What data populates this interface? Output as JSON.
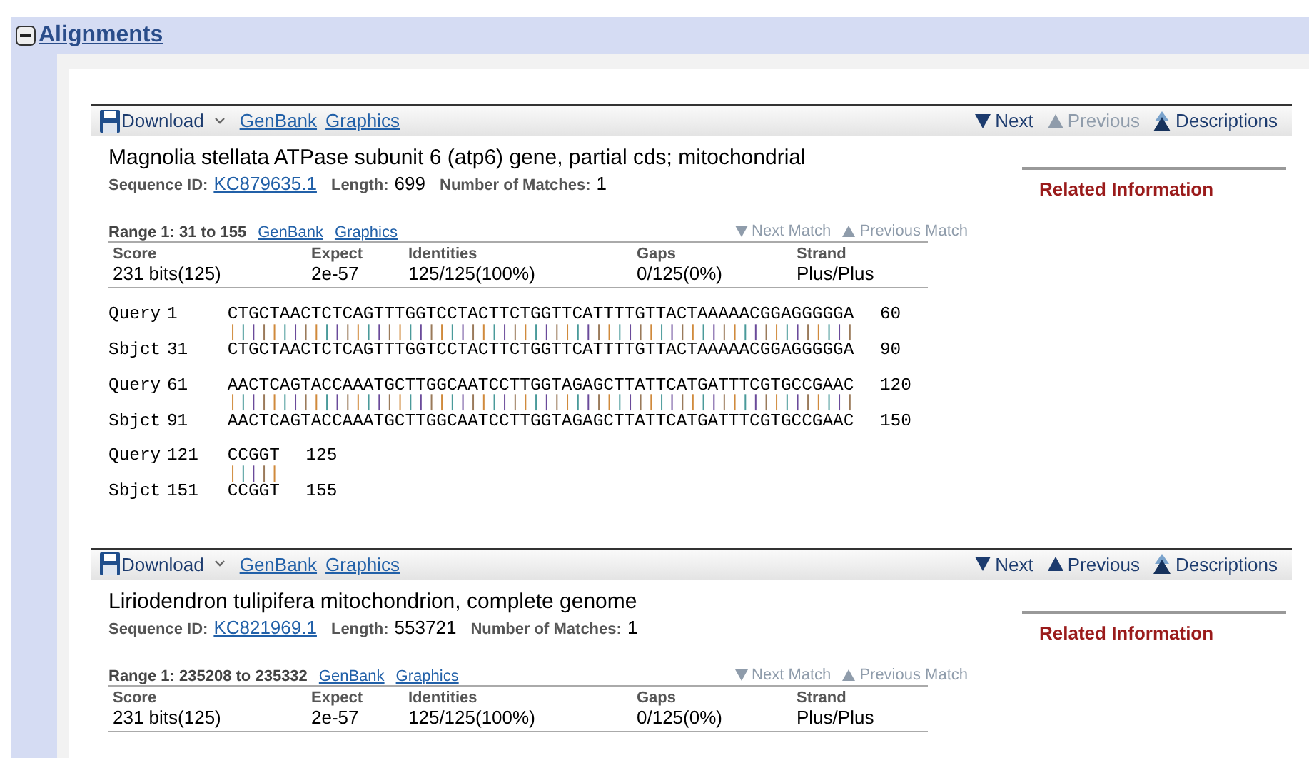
{
  "header": {
    "title": "Alignments",
    "expanded": true
  },
  "sections": [
    {
      "toolbar": {
        "download": "Download",
        "links": [
          "GenBank",
          "Graphics"
        ],
        "nav": [
          {
            "label": "Next",
            "kind": "down",
            "disabled": false
          },
          {
            "label": "Previous",
            "kind": "up",
            "disabled": true
          },
          {
            "label": "Descriptions",
            "kind": "top",
            "disabled": false
          }
        ]
      },
      "title": "Magnolia stellata ATPase subunit 6 (atp6) gene, partial cds; mitochondrial",
      "info": [
        {
          "label": "Sequence ID:",
          "value": "KC879635.1",
          "kind": "link"
        },
        {
          "label": "Length:",
          "value": "699",
          "kind": "text"
        },
        {
          "label": "Number of Matches:",
          "value": "1",
          "kind": "text"
        }
      ],
      "related": "Related Information",
      "range": "Range 1: 31 to 155",
      "range_links": [
        "GenBank",
        "Graphics"
      ],
      "match_nav": [
        {
          "label": "Next Match",
          "kind": "down",
          "disabled": true
        },
        {
          "label": "Previous Match",
          "kind": "up",
          "disabled": true
        }
      ],
      "stats": [
        {
          "header": "Score",
          "value": "231 bits(125)"
        },
        {
          "header": "Expect",
          "value": "2e-57"
        },
        {
          "header": "Identities",
          "value": "125/125(100%)"
        },
        {
          "header": "Gaps",
          "value": "0/125(0%)"
        },
        {
          "header": "Strand",
          "value": "Plus/Plus"
        }
      ],
      "blocks": [
        {
          "rows": [
            {
              "label": "Query",
              "start": "1",
              "seq": "CTGCTAACTCTCAGTTTGGTCCTACTTCTGGTTCATTTTGTTACTAAAAACGGAGGGGGA",
              "end": "60"
            },
            {
              "label": "Sbjct",
              "start": "31",
              "seq": "CTGCTAACTCTCAGTTTGGTCCTACTTCTGGTTCATTTTGTTACTAAAAACGGAGGGGGA",
              "end": "90"
            }
          ],
          "match": "||||||||||||||||||||||||||||||||||||||||||||||||||||||||||||"
        },
        {
          "rows": [
            {
              "label": "Query",
              "start": "61",
              "seq": "AACTCAGTACCAAATGCTTGGCAATCCTTGGTAGAGCTTATTCATGATTTCGTGCCGAAC",
              "end": "120"
            },
            {
              "label": "Sbjct",
              "start": "91",
              "seq": "AACTCAGTACCAAATGCTTGGCAATCCTTGGTAGAGCTTATTCATGATTTCGTGCCGAAC",
              "end": "150"
            }
          ],
          "match": "||||||||||||||||||||||||||||||||||||||||||||||||||||||||||||"
        },
        {
          "rows": [
            {
              "label": "Query",
              "start": "121",
              "seq": "CCGGT",
              "end": "125"
            },
            {
              "label": "Sbjct",
              "start": "151",
              "seq": "CCGGT",
              "end": "155"
            }
          ],
          "match": "|||||"
        }
      ]
    },
    {
      "toolbar": {
        "download": "Download",
        "links": [
          "GenBank",
          "Graphics"
        ],
        "nav": [
          {
            "label": "Next",
            "kind": "down",
            "disabled": false
          },
          {
            "label": "Previous",
            "kind": "up",
            "disabled": false
          },
          {
            "label": "Descriptions",
            "kind": "top",
            "disabled": false
          }
        ]
      },
      "title": "Liriodendron tulipifera mitochondrion, complete genome",
      "info": [
        {
          "label": "Sequence ID:",
          "value": "KC821969.1",
          "kind": "link"
        },
        {
          "label": "Length:",
          "value": "553721",
          "kind": "text"
        },
        {
          "label": "Number of Matches:",
          "value": "1",
          "kind": "text"
        }
      ],
      "related": "Related Information",
      "range": "Range 1: 235208 to 235332",
      "range_links": [
        "GenBank",
        "Graphics"
      ],
      "match_nav": [
        {
          "label": "Next Match",
          "kind": "down",
          "disabled": true
        },
        {
          "label": "Previous Match",
          "kind": "up",
          "disabled": true
        }
      ],
      "stats": [
        {
          "header": "Score",
          "value": "231 bits(125)"
        },
        {
          "header": "Expect",
          "value": "2e-57"
        },
        {
          "header": "Identities",
          "value": "125/125(100%)"
        },
        {
          "header": "Gaps",
          "value": "0/125(0%)"
        },
        {
          "header": "Strand",
          "value": "Plus/Plus"
        }
      ]
    }
  ]
}
